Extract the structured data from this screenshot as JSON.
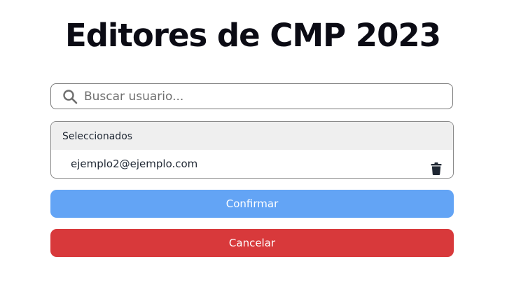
{
  "page": {
    "title": "Editores de CMP 2023"
  },
  "search": {
    "placeholder": "Buscar usuario...",
    "icon": "search-icon"
  },
  "selected": {
    "header": "Seleccionados",
    "items": [
      {
        "email": "ejemplo2@ejemplo.com",
        "remove_icon": "trash-icon"
      }
    ]
  },
  "actions": {
    "confirm_label": "Confirmar",
    "cancel_label": "Cancelar"
  },
  "colors": {
    "confirm": "#63a4f5",
    "cancel": "#d8393b",
    "header_bg": "#efefef",
    "text": "#1f2733"
  }
}
